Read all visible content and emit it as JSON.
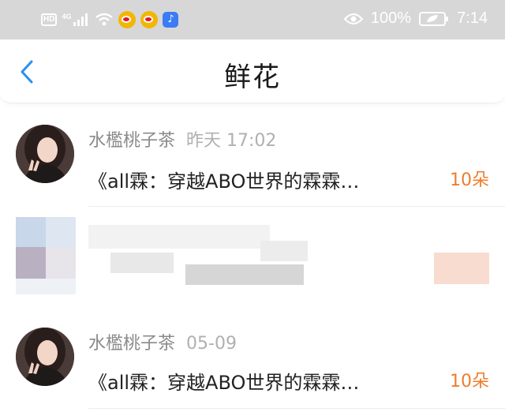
{
  "status_bar": {
    "hd": "HD",
    "network": "4G",
    "battery_percent": "100%",
    "time": "7:14",
    "icons": [
      "hd-icon",
      "signal-icon",
      "wifi-icon",
      "weibo-icon",
      "weibo-icon",
      "music-app-icon",
      "eye-icon",
      "battery-icon"
    ]
  },
  "header": {
    "title": "鲜花",
    "back_icon": "chevron-left-icon"
  },
  "items": [
    {
      "user": "水檻桃子茶",
      "time": "昨天 17:02",
      "title": "《all霖：穿越ABO世界的霖霖…",
      "count": "10朵"
    },
    {
      "user": "水檻桃子茶",
      "time": "05-09",
      "title": "《all霖：穿越ABO世界的霖霖…",
      "count": "10朵"
    }
  ],
  "colors": {
    "accent_blue": "#2a8ff0",
    "count_orange": "#f07c2a",
    "status_bar": "#d7d7d7"
  }
}
